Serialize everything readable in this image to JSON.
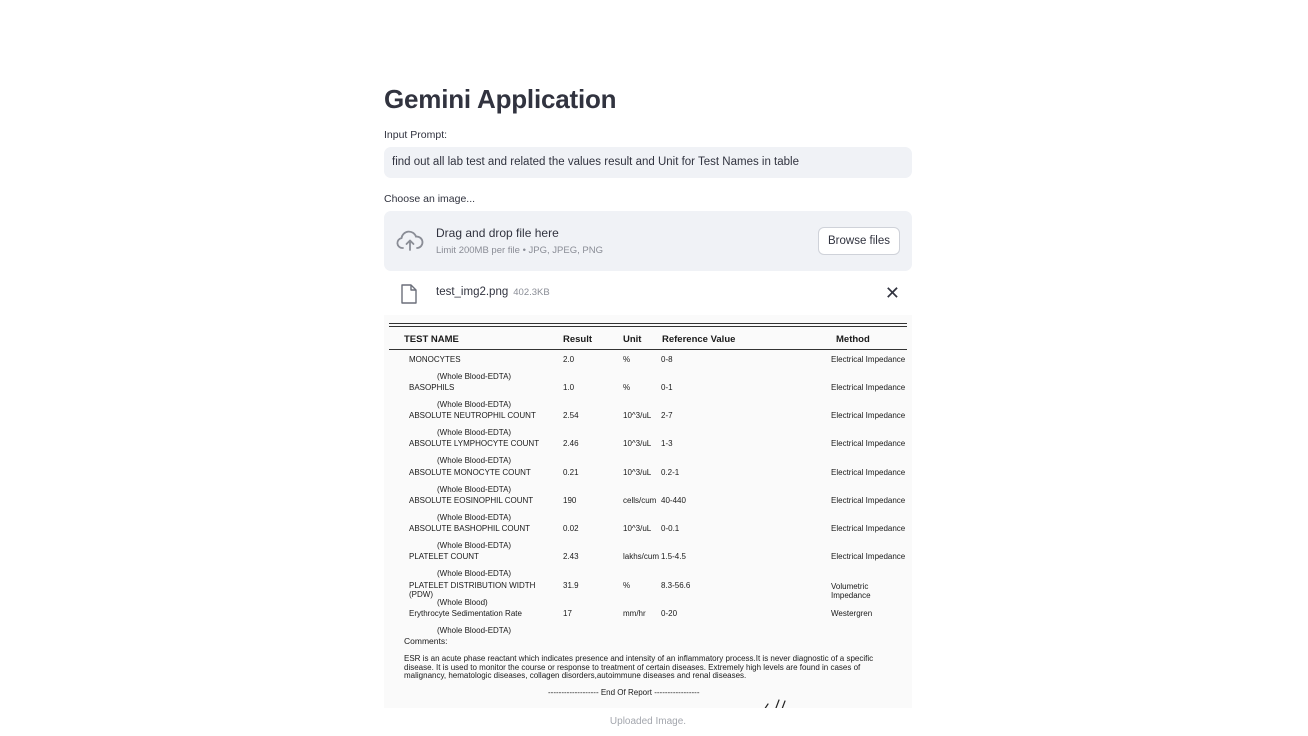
{
  "app": {
    "title": "Gemini Application"
  },
  "prompt": {
    "label": "Input Prompt:",
    "value": "find out all lab test and related the values result and Unit for Test Names in table"
  },
  "uploader": {
    "label": "Choose an image...",
    "drop_title": "Drag and drop file here",
    "drop_subtitle": "Limit 200MB per file • JPG, JPEG, PNG",
    "browse_label": "Browse files",
    "cloud_icon": "cloud-upload-icon",
    "file": {
      "name": "test_img2.png",
      "size": "402.3KB",
      "icon": "file-icon",
      "close_icon": "close-icon"
    }
  },
  "report": {
    "headers": {
      "test_name": "TEST NAME",
      "result": "Result",
      "unit": "Unit",
      "reference": "Reference Value",
      "method": "Method"
    },
    "rows": [
      {
        "name": "MONOCYTES",
        "result": "2.0",
        "unit": "%",
        "ref": "0-8",
        "method": "Electrical Impedance",
        "sub": "(Whole Blood-EDTA)"
      },
      {
        "name": "BASOPHILS",
        "result": "1.0",
        "unit": "%",
        "ref": "0-1",
        "method": "Electrical Impedance",
        "sub": "(Whole Blood-EDTA)"
      },
      {
        "name": "ABSOLUTE NEUTROPHIL COUNT",
        "result": "2.54",
        "unit": "10^3/uL",
        "ref": "2-7",
        "method": "Electrical Impedance",
        "sub": "(Whole Blood-EDTA)"
      },
      {
        "name": "ABSOLUTE LYMPHOCYTE COUNT",
        "result": "2.46",
        "unit": "10^3/uL",
        "ref": "1-3",
        "method": "Electrical Impedance",
        "sub": "(Whole Blood-EDTA)"
      },
      {
        "name": "ABSOLUTE MONOCYTE COUNT",
        "result": "0.21",
        "unit": "10^3/uL",
        "ref": "0.2-1",
        "method": "Electrical Impedance",
        "sub": "(Whole Blood-EDTA)"
      },
      {
        "name": "ABSOLUTE EOSINOPHIL COUNT",
        "result": "190",
        "unit": "cells/cum",
        "ref": "40-440",
        "method": "Electrical Impedance",
        "sub": "(Whole Blood-EDTA)"
      },
      {
        "name": "ABSOLUTE BASHOPHIL COUNT",
        "result": "0.02",
        "unit": "10^3/uL",
        "ref": "0-0.1",
        "method": "Electrical Impedance",
        "sub": "(Whole Blood-EDTA)"
      },
      {
        "name": "PLATELET COUNT",
        "result": "2.43",
        "unit": "lakhs/cum",
        "ref": "1.5-4.5",
        "method": "Electrical Impedance",
        "sub": "(Whole Blood-EDTA)"
      },
      {
        "name": "PLATELET DISTRIBUTION WIDTH",
        "name2": "(PDW)",
        "result": "31.9",
        "unit": "%",
        "ref": "8.3-56.6",
        "method": "Volumetric",
        "method2": "Impedance",
        "sub": "(Whole Blood)"
      },
      {
        "name": "Erythrocyte Sedimentation Rate",
        "result": "17",
        "unit": "mm/hr",
        "ref": "0-20",
        "method": "Westergren",
        "sub": "(Whole Blood-EDTA)"
      }
    ],
    "comments_label": "Comments:",
    "esr_note": "ESR is an acute phase reactant which indicates presence and intensity of an inflammatory process.It is never diagnostic of a specific disease. It is used to monitor the course or response to treatment of certain diseases. Extremely high levels are found in cases of malignancy, hematologic diseases, collagen disorders,autoimmune diseases and renal diseases.",
    "end_of_report": "------------------- End Of Report -----------------"
  },
  "caption": "Uploaded Image."
}
